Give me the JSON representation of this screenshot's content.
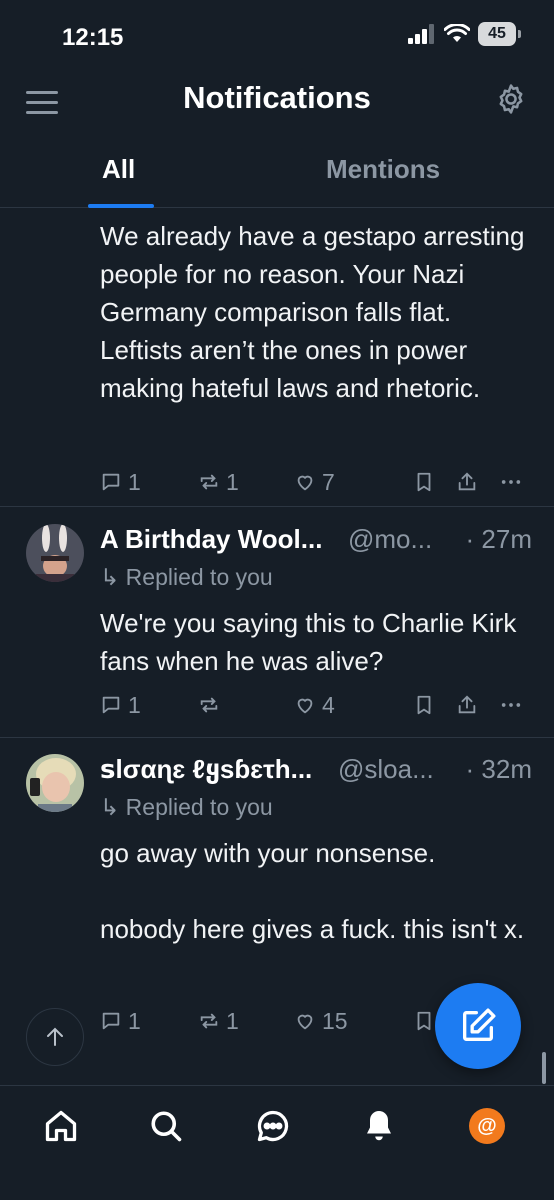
{
  "status_bar": {
    "time": "12:15",
    "battery": "45"
  },
  "header": {
    "title": "Notifications"
  },
  "tabs": [
    {
      "label": "All"
    },
    {
      "label": "Mentions"
    }
  ],
  "posts": [
    {
      "text": "Kirk is wild.\nWe already have a gestapo arresting people for no reason. Your Nazi Germany comparison falls flat. Leftists aren’t the ones in power making hateful laws and rhetoric.",
      "replies": "1",
      "reposts": "1",
      "likes": "7"
    },
    {
      "author": "A Birthday Wool...",
      "handle": "@mo...",
      "time": "· 27m",
      "replied": "Replied to you",
      "text": "We're you saying this to Charlie Kirk fans when he was alive?",
      "replies": "1",
      "reposts": "",
      "likes": "4"
    },
    {
      "author": "ꜱlσαɳɛ ℓყѕɓɛτh...",
      "handle": "@sloa...",
      "time": "· 32m",
      "replied": "Replied to you",
      "text": "go away with your nonsense.\n\nnobody here gives a fuck. this isn't x.",
      "replies": "1",
      "reposts": "1",
      "likes": "15"
    }
  ],
  "tabbar": {
    "profile_initial": "@"
  },
  "colors": {
    "background": "#161e27",
    "accent": "#1d7cf2",
    "muted": "#8c97a3",
    "profile": "#f27a1d"
  }
}
